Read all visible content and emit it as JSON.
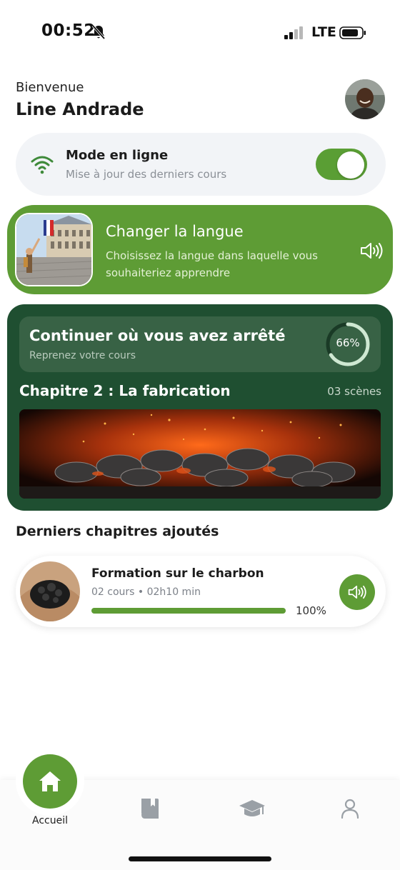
{
  "status_bar": {
    "time": "00:52",
    "network": "LTE"
  },
  "header": {
    "welcome": "Bienvenue",
    "user_name": "Line Andrade"
  },
  "online_mode": {
    "title": "Mode en ligne",
    "subtitle": "Mise à jour des derniers cours",
    "enabled": true
  },
  "language_card": {
    "title": "Changer la langue",
    "description": "Choisissez la langue dans laquelle vous souhaiteriez apprendre"
  },
  "continue_card": {
    "title": "Continuer où vous avez arrêté",
    "subtitle": "Reprenez votre cours",
    "progress_value": 66,
    "progress_label": "66%",
    "chapter_title": "Chapitre 2 : La fabrication",
    "scenes": "03 scènes"
  },
  "latest": {
    "heading": "Derniers chapitres ajoutés",
    "courses": [
      {
        "title": "Formation sur le charbon",
        "meta": "02 cours • 02h10 min",
        "progress": 100,
        "progress_label": "100%"
      }
    ]
  },
  "nav": {
    "home_label": "Accueil",
    "active": "home"
  },
  "colors": {
    "primary_green": "#5e9c35",
    "dark_green": "#1f4f31",
    "panel_green": "#386245",
    "ring_light": "#cfe8d2"
  },
  "icons": [
    "bell-slash-icon",
    "signal-icon",
    "battery-icon",
    "wifi-icon",
    "speaker-icon",
    "home-icon",
    "book-icon",
    "graduation-cap-icon",
    "user-icon"
  ]
}
